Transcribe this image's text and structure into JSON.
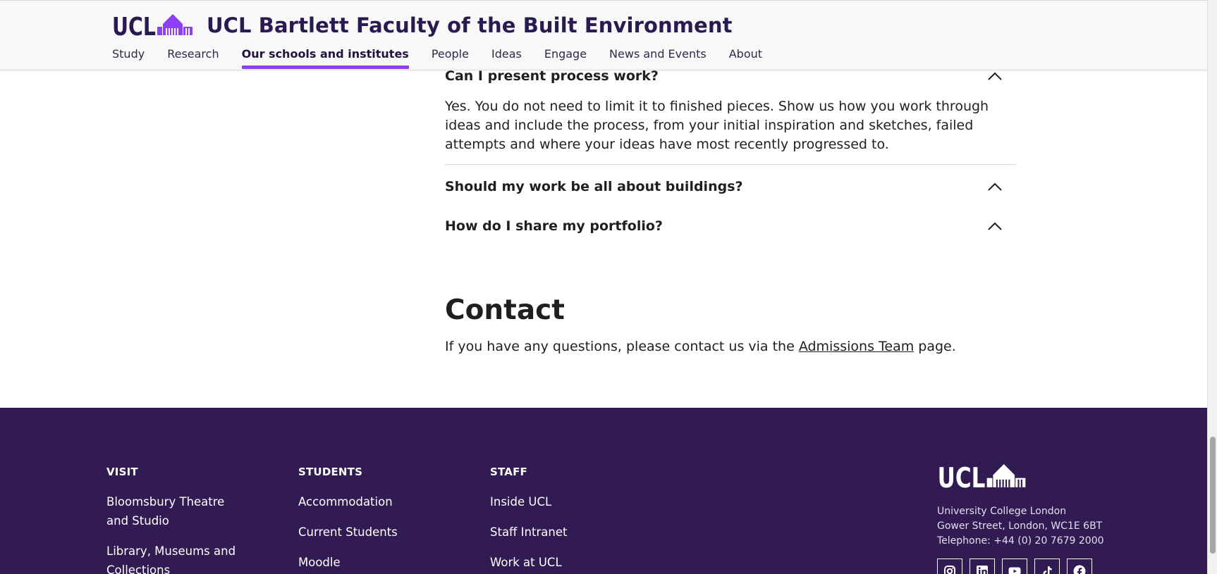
{
  "header": {
    "logo_alt": "UCL",
    "site_title": "UCL Bartlett Faculty of the Built Environment",
    "nav": [
      {
        "label": "Study"
      },
      {
        "label": "Research"
      },
      {
        "label": "Our schools and institutes",
        "active": true
      },
      {
        "label": "People"
      },
      {
        "label": "Ideas"
      },
      {
        "label": "Engage"
      },
      {
        "label": "News and Events"
      },
      {
        "label": "About"
      }
    ]
  },
  "faq": [
    {
      "question": "Can I present process work?",
      "answer": "Yes. You do not need to limit it to finished pieces. Show us how you work through ideas and include the process, from your initial inspiration and sketches, failed attempts and where your ideas have most recently progressed to.",
      "expanded": true
    },
    {
      "question": "Should my work be all about buildings?",
      "expanded": false
    },
    {
      "question": "How do I share my portfolio?",
      "expanded": false
    }
  ],
  "contact": {
    "title": "Contact",
    "text_before": "If you have any questions, please contact us via the",
    "link_label": "Admissions Team",
    "text_after": "page."
  },
  "footer": {
    "visit": {
      "heading": "VISIT",
      "links": [
        "Bloomsbury Theatre and Studio",
        "Library, Museums and Collections"
      ]
    },
    "students": {
      "heading": "STUDENTS",
      "links": [
        "Accommodation",
        "Current Students",
        "Moodle"
      ]
    },
    "staff": {
      "heading": "STAFF",
      "links": [
        "Inside UCL",
        "Staff Intranet",
        "Work at UCL"
      ]
    },
    "address": {
      "name": "University College London",
      "street": "Gower Street, London, WC1E 6BT",
      "phone": "Telephone: +44 (0) 20 7679 2000"
    },
    "socials": [
      "instagram-icon",
      "linkedin-icon",
      "youtube-icon",
      "tiktok-icon",
      "facebook-icon"
    ]
  },
  "colors": {
    "accent": "#8c3ff4",
    "footer_bg": "#321b52",
    "title": "#2a1a52"
  }
}
